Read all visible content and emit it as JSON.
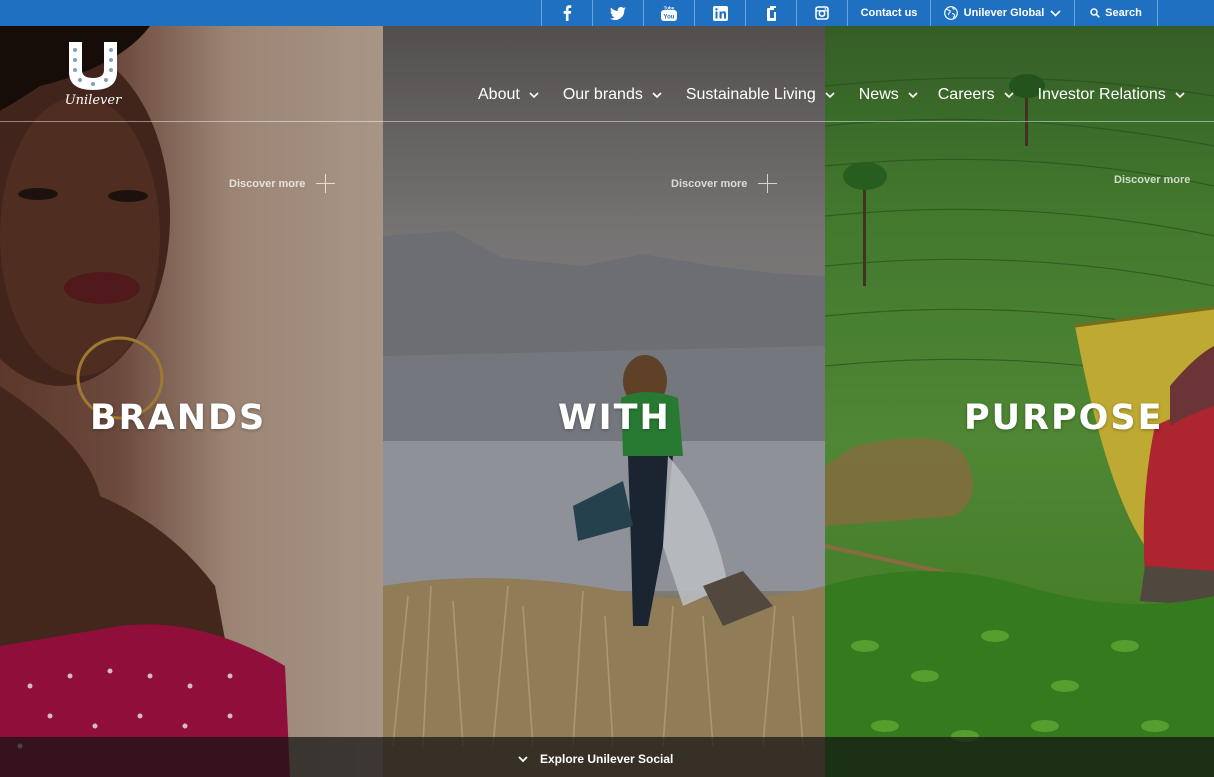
{
  "utility_bar": {
    "social_icons": [
      "facebook-icon",
      "twitter-icon",
      "youtube-icon",
      "linkedin-icon",
      "glassdoor-icon",
      "instagram-icon"
    ],
    "contact_label": "Contact us",
    "region_label": "Unilever Global",
    "search_label": "Search",
    "bar_color": "#1f70c1"
  },
  "brand": {
    "logo_text": "Unilever"
  },
  "nav": {
    "items": [
      {
        "label": "About"
      },
      {
        "label": "Our brands"
      },
      {
        "label": "Sustainable Living"
      },
      {
        "label": "News"
      },
      {
        "label": "Careers"
      },
      {
        "label": "Investor Relations"
      }
    ]
  },
  "hero": {
    "panels": [
      {
        "discover_label": "Discover more",
        "heading": "BRANDS"
      },
      {
        "discover_label": "Discover more",
        "heading": "WITH"
      },
      {
        "discover_label": "Discover more",
        "heading": "PURPOSE"
      }
    ]
  },
  "footer_bar": {
    "explore_label": "Explore Unilever Social"
  }
}
